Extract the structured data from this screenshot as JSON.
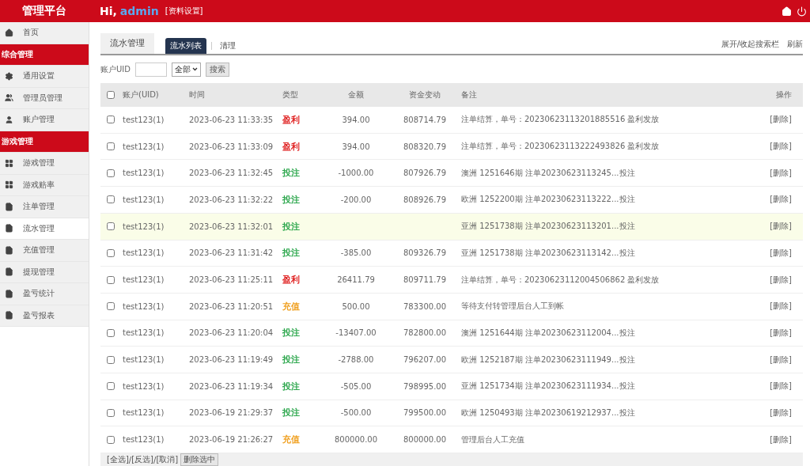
{
  "header": {
    "brand": "管理平台",
    "greeting": "Hi,",
    "user": "admin",
    "profile_link": "[资料设置]"
  },
  "sidebar": {
    "items": [
      {
        "kind": "link",
        "label": "首页",
        "selected": false
      },
      {
        "kind": "section",
        "label": "综合管理"
      },
      {
        "kind": "link",
        "label": "通用设置",
        "selected": false
      },
      {
        "kind": "link",
        "label": "管理员管理",
        "selected": false
      },
      {
        "kind": "link",
        "label": "账户管理",
        "selected": false
      },
      {
        "kind": "section",
        "label": "游戏管理"
      },
      {
        "kind": "link",
        "label": "游戏管理",
        "selected": false
      },
      {
        "kind": "link",
        "label": "游戏赔率",
        "selected": false
      },
      {
        "kind": "link",
        "label": "注单管理",
        "selected": false
      },
      {
        "kind": "link",
        "label": "流水管理",
        "selected": true
      },
      {
        "kind": "link",
        "label": "充值管理",
        "selected": false
      },
      {
        "kind": "link",
        "label": "提现管理",
        "selected": false
      },
      {
        "kind": "link",
        "label": "盈亏统计",
        "selected": false
      },
      {
        "kind": "link",
        "label": "盈亏报表",
        "selected": false
      }
    ]
  },
  "page": {
    "title": "流水管理",
    "tabs": [
      {
        "label": "流水列表",
        "selected": true
      },
      {
        "label": "清理",
        "selected": false
      }
    ],
    "actions": [
      "展开/收起搜索栏",
      "刷新"
    ]
  },
  "search": {
    "label": "账户UID",
    "select": "全部",
    "button": "搜索"
  },
  "table": {
    "select_all_checked": false,
    "columns": [
      "账户(UID)",
      "时间",
      "类型",
      "金额",
      "资金变动",
      "备注",
      "操作"
    ],
    "rows": [
      {
        "checked": false,
        "highlighted": false,
        "account": "test123(1)",
        "time": "2023-06-23 11:33:35",
        "type": "盈利",
        "color": "#e02424",
        "amount": "394.00",
        "balance": "808714.79",
        "remark": "注单结算，单号：20230623113201885516 盈利发放",
        "action": "[删除]"
      },
      {
        "checked": false,
        "highlighted": false,
        "account": "test123(1)",
        "time": "2023-06-23 11:33:09",
        "type": "盈利",
        "color": "#e02424",
        "amount": "394.00",
        "balance": "808320.79",
        "remark": "注单结算，单号：20230623113222493826 盈利发放",
        "action": "[删除]"
      },
      {
        "checked": false,
        "highlighted": false,
        "account": "test123(1)",
        "time": "2023-06-23 11:32:45",
        "type": "投注",
        "color": "#2fa84f",
        "amount": "-1000.00",
        "balance": "807926.79",
        "remark": "澳洲 1251646期 注单20230623113245...投注",
        "action": "[删除]"
      },
      {
        "checked": false,
        "highlighted": false,
        "account": "test123(1)",
        "time": "2023-06-23 11:32:22",
        "type": "投注",
        "color": "#2fa84f",
        "amount": "-200.00",
        "balance": "808926.79",
        "remark": "欧洲 1252200期 注单20230623113222...投注",
        "action": "[删除]"
      },
      {
        "checked": false,
        "highlighted": true,
        "account": "test123(1)",
        "time": "2023-06-23 11:32:01",
        "type": "投注",
        "color": "#2fa84f",
        "remark": "亚洲 1251738期 注单20230623113201...投注",
        "action": "[删除]"
      },
      {
        "checked": false,
        "highlighted": false,
        "account": "test123(1)",
        "time": "2023-06-23 11:31:42",
        "type": "投注",
        "color": "#2fa84f",
        "amount": "-385.00",
        "balance": "809326.79",
        "remark": "亚洲 1251738期 注单20230623113142...投注",
        "action": "[删除]"
      },
      {
        "checked": false,
        "highlighted": false,
        "account": "test123(1)",
        "time": "2023-06-23 11:25:11",
        "type": "盈利",
        "color": "#e02424",
        "amount": "26411.79",
        "balance": "809711.79",
        "remark": "注单结算，单号：20230623112004506862 盈利发放",
        "action": "[删除]"
      },
      {
        "checked": false,
        "highlighted": false,
        "account": "test123(1)",
        "time": "2023-06-23 11:20:51",
        "type": "充值",
        "color": "#f0a020",
        "amount": "500.00",
        "balance": "783300.00",
        "remark": "等待支付转管理后台人工到帐",
        "action": "[删除]"
      },
      {
        "checked": false,
        "highlighted": false,
        "account": "test123(1)",
        "time": "2023-06-23 11:20:04",
        "type": "投注",
        "color": "#2fa84f",
        "amount": "-13407.00",
        "balance": "782800.00",
        "remark": "澳洲 1251644期 注单20230623112004...投注",
        "action": "[删除]"
      },
      {
        "checked": false,
        "highlighted": false,
        "account": "test123(1)",
        "time": "2023-06-23 11:19:49",
        "type": "投注",
        "color": "#2fa84f",
        "amount": "-2788.00",
        "balance": "796207.00",
        "remark": "欧洲 1252187期 注单20230623111949...投注",
        "action": "[删除]"
      },
      {
        "checked": false,
        "highlighted": false,
        "account": "test123(1)",
        "time": "2023-06-23 11:19:34",
        "type": "投注",
        "color": "#2fa84f",
        "amount": "-505.00",
        "balance": "798995.00",
        "remark": "亚洲 1251734期 注单20230623111934...投注",
        "action": "[删除]"
      },
      {
        "checked": false,
        "highlighted": false,
        "account": "test123(1)",
        "time": "2023-06-19 21:29:37",
        "type": "投注",
        "color": "#2fa84f",
        "amount": "-500.00",
        "balance": "799500.00",
        "remark": "欧洲 1250493期 注单20230619212937...投注",
        "action": "[删除]"
      },
      {
        "checked": false,
        "highlighted": false,
        "account": "test123(1)",
        "time": "2023-06-19 21:26:27",
        "type": "充值",
        "color": "#f0a020",
        "amount": "800000.00",
        "balance": "800000.00",
        "remark": "管理后台人工充值",
        "action": "[删除]"
      }
    ]
  },
  "footer": {
    "links": [
      "[全选]",
      "[反选]",
      "[取消]"
    ],
    "separator": "/",
    "button": "删除选中"
  }
}
